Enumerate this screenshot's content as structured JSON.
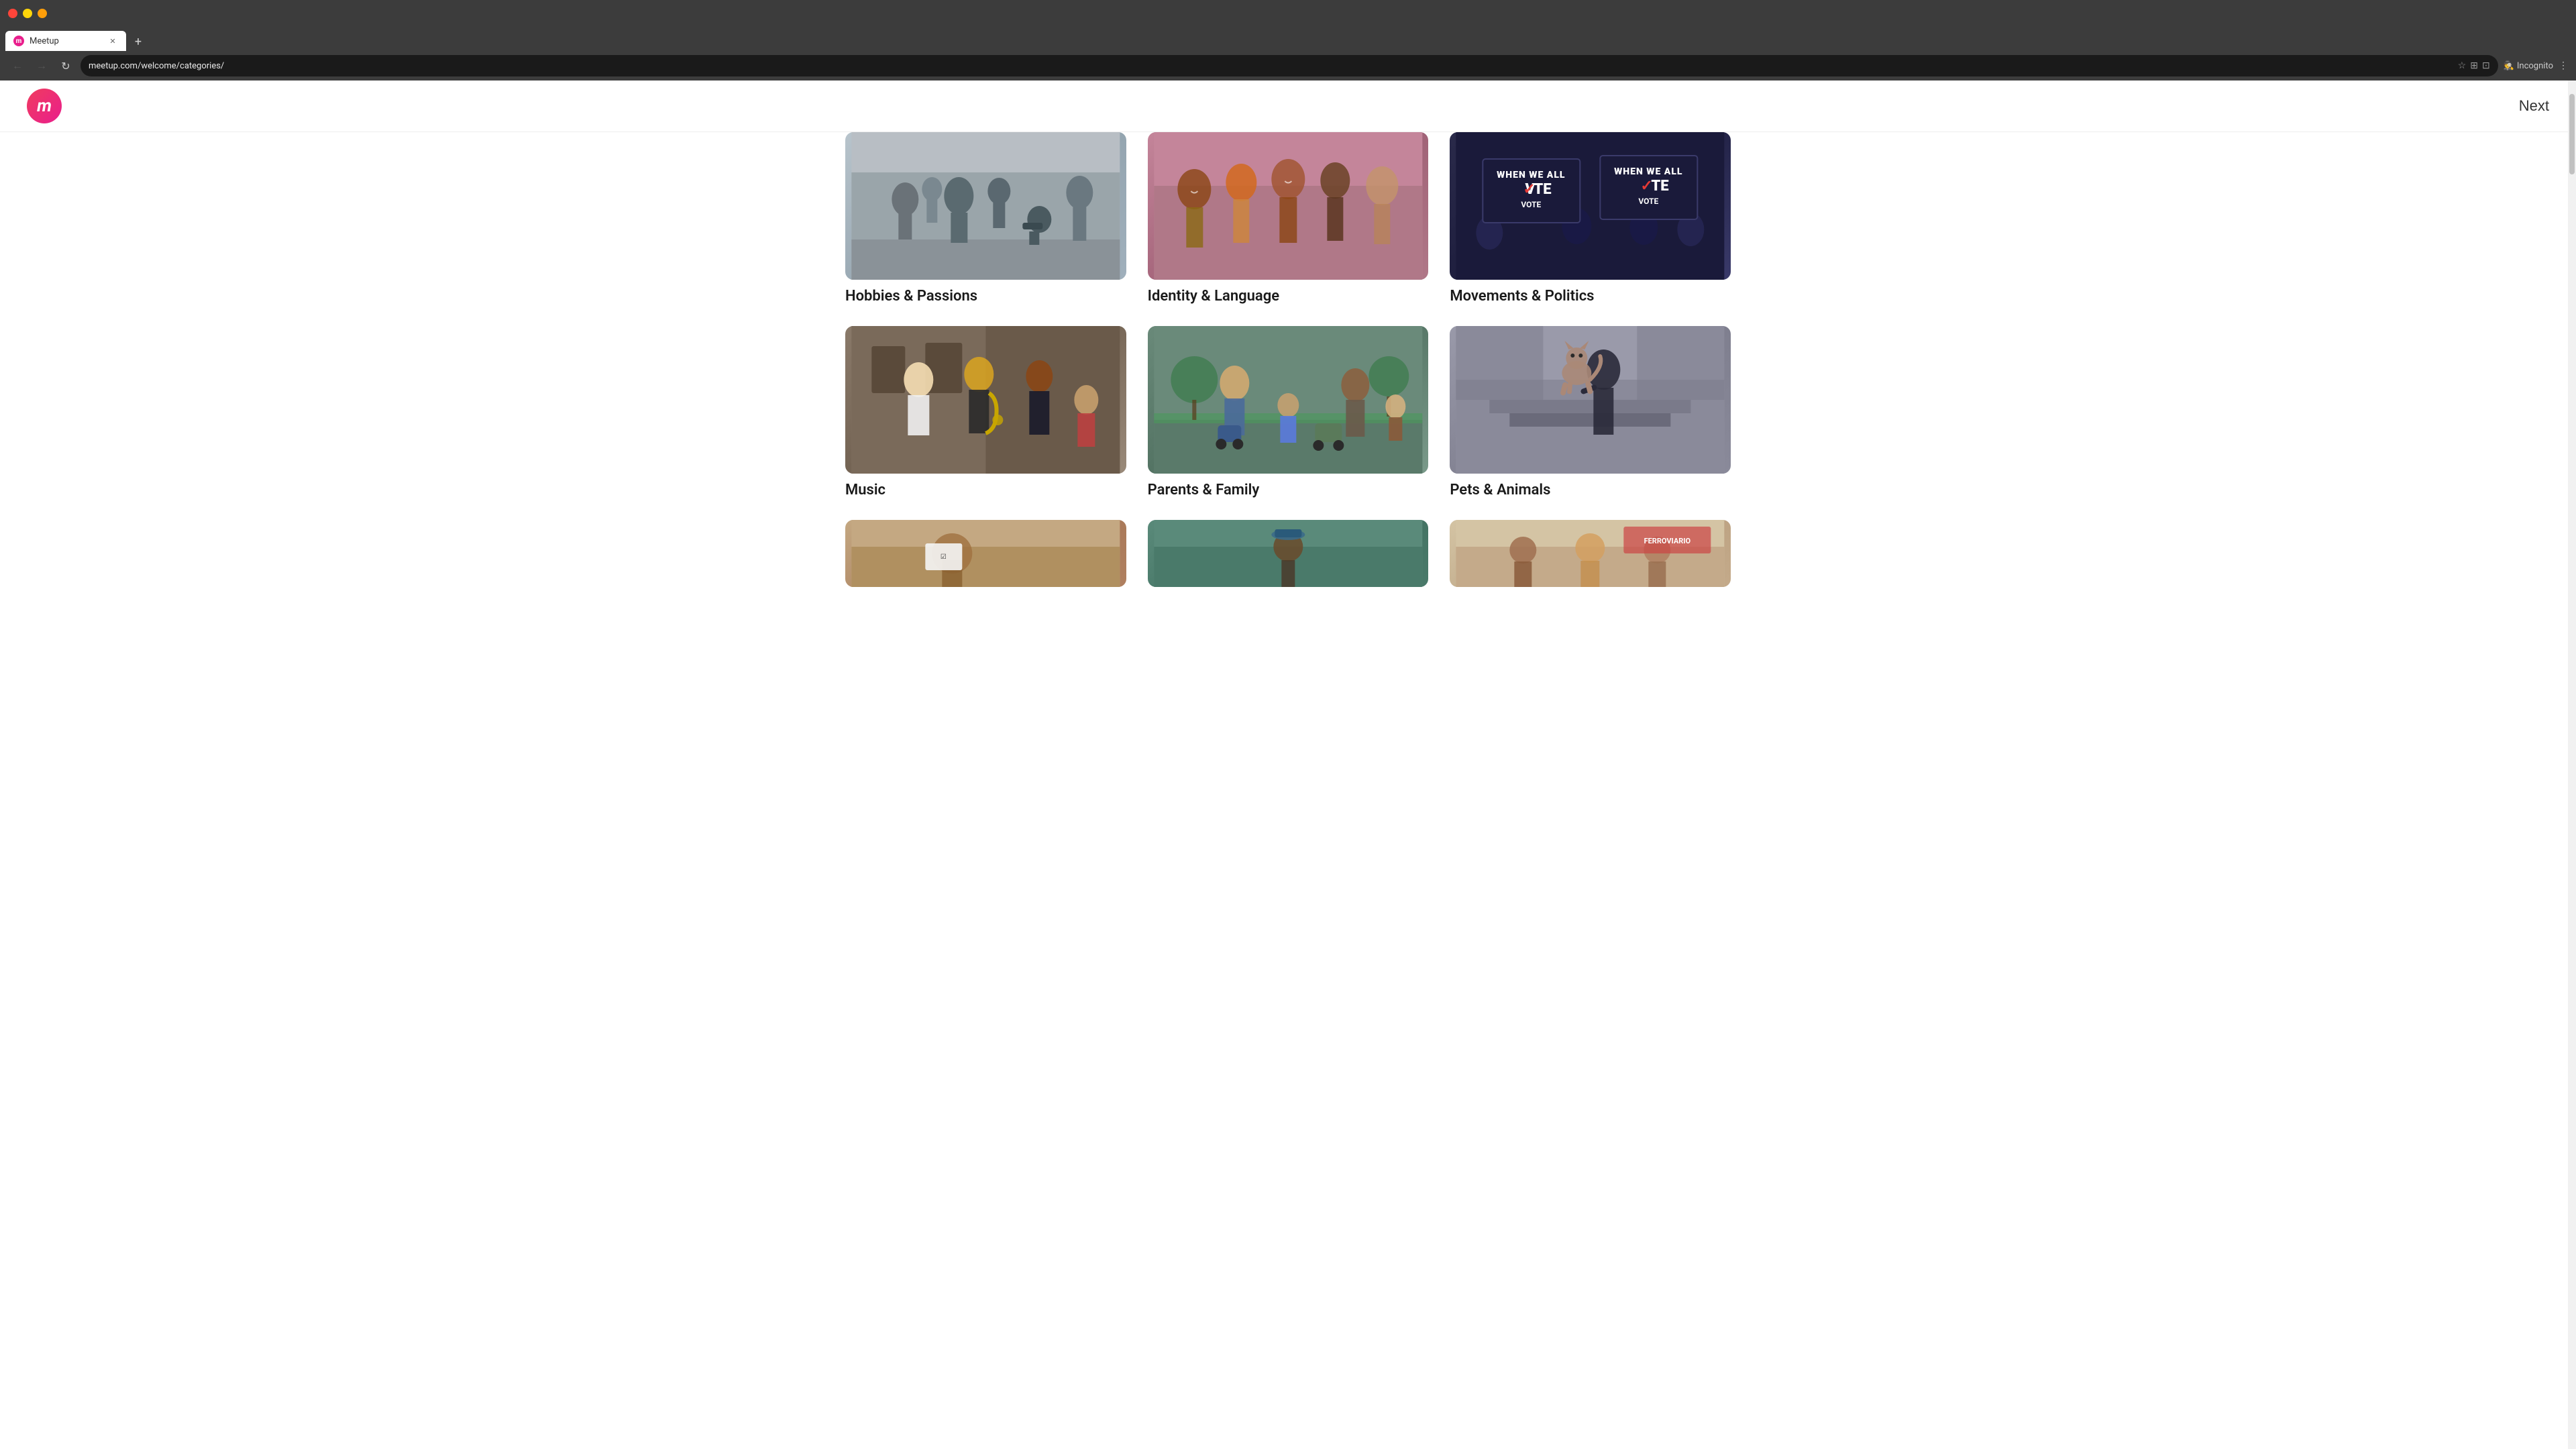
{
  "browser": {
    "tab_title": "Meetup",
    "tab_new_label": "+",
    "address": "meetup.com/welcome/categories/",
    "nav_back": "←",
    "nav_forward": "→",
    "nav_refresh": "↻",
    "bookmark_icon": "☆",
    "extensions_icon": "⊞",
    "profile_icon": "👤",
    "incognito_label": "Incognito",
    "more_icon": "⋮",
    "minimize_title": "Minimize",
    "maximize_title": "Maximize",
    "close_title": "Close"
  },
  "header": {
    "logo_letter": "m",
    "next_button_label": "Next"
  },
  "categories": [
    {
      "id": "hobbies",
      "label": "Hobbies & Passions",
      "image_theme": "hobbies",
      "alt": "People with cameras at an outdoor event"
    },
    {
      "id": "identity",
      "label": "Identity & Language",
      "image_theme": "identity",
      "alt": "Group of diverse friends laughing together"
    },
    {
      "id": "movements",
      "label": "Movements & Politics",
      "image_theme": "movements",
      "alt": "People holding When We All Vote signs",
      "vote_text_line1": "WHEN WE ALL",
      "vote_text_line2": "VOTE",
      "vote_text_line1b": "WHEN WE ALL",
      "vote_text_line2b": "VOTE"
    },
    {
      "id": "music",
      "label": "Music",
      "image_theme": "music",
      "alt": "Musicians playing saxophone outdoors"
    },
    {
      "id": "parents",
      "label": "Parents & Family",
      "image_theme": "parents",
      "alt": "Families with children and strollers in a park"
    },
    {
      "id": "pets",
      "label": "Pets & Animals",
      "image_theme": "pets",
      "alt": "Person with a cat"
    },
    {
      "id": "bottom1",
      "label": "",
      "image_theme": "bottom1",
      "alt": "Category image 7"
    },
    {
      "id": "bottom2",
      "label": "",
      "image_theme": "bottom2",
      "alt": "Category image 8"
    },
    {
      "id": "bottom3",
      "label": "",
      "image_theme": "bottom3",
      "alt": "Category image 9"
    }
  ],
  "colors": {
    "accent_pink": "#e91e8c",
    "text_dark": "#1a1a1a",
    "background": "#ffffff"
  }
}
